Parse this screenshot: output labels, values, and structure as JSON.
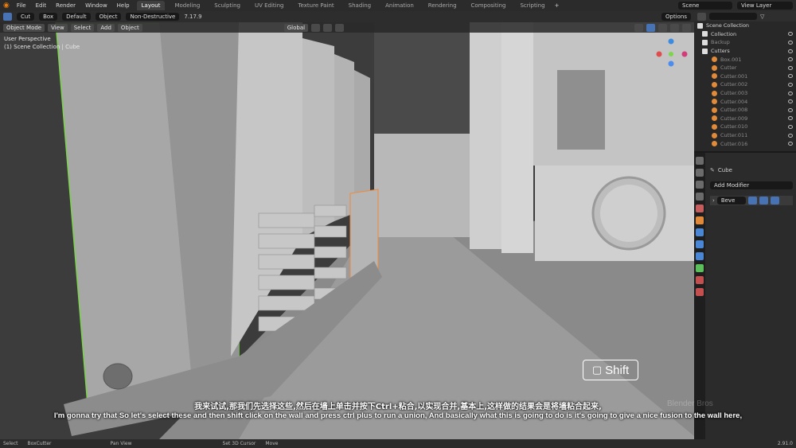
{
  "menu": [
    "File",
    "Edit",
    "Render",
    "Window",
    "Help"
  ],
  "workspaces": [
    "Layout",
    "Modeling",
    "Sculpting",
    "UV Editing",
    "Texture Paint",
    "Shading",
    "Animation",
    "Rendering",
    "Compositing",
    "Scripting"
  ],
  "active_workspace": "Layout",
  "scene": "Scene",
  "view_layer": "View Layer",
  "toolhdr": {
    "mode": "Cut",
    "shape": "Box",
    "default": "Default",
    "object": "Object",
    "boolean": "Non-Destructive",
    "version": "7.17.9",
    "options": "Options"
  },
  "vphdr": {
    "mode": "Object Mode",
    "view": "View",
    "select": "Select",
    "add": "Add",
    "object": "Object",
    "transform": "Global"
  },
  "viewport": {
    "line1": "User Perspective",
    "line2": "(1) Scene Collection | Cube"
  },
  "outliner": {
    "root": "Scene Collection",
    "rows": [
      {
        "label": "Collection",
        "dim": false
      },
      {
        "label": "Backup",
        "dim": true
      },
      {
        "label": "Cutters",
        "dim": false
      },
      {
        "label": "Box.001",
        "dim": true
      },
      {
        "label": "Cutter",
        "dim": true
      },
      {
        "label": "Cutter.001",
        "dim": true
      },
      {
        "label": "Cutter.002",
        "dim": true
      },
      {
        "label": "Cutter.003",
        "dim": true
      },
      {
        "label": "Cutter.004",
        "dim": true
      },
      {
        "label": "Cutter.008",
        "dim": true
      },
      {
        "label": "Cutter.009",
        "dim": true
      },
      {
        "label": "Cutter.010",
        "dim": true
      },
      {
        "label": "Cutter.011",
        "dim": true
      },
      {
        "label": "Cutter.016",
        "dim": true
      }
    ]
  },
  "properties": {
    "object": "Cube",
    "add_modifier": "Add Modifier",
    "modifier": "Beve"
  },
  "subtitle_cn": "我来试试,那我们先选择这些,然后在墙上单击并按下Ctrl+粘合,以实现合并,基本上,这样做的结果会是将墙粘合起来,",
  "subtitle_en": "I'm gonna try that So let's select these and then shift click on the wall and press ctrl plus to run a union, And basically what this is going to do is it's going to give a nice fusion to the wall here,",
  "key_overlay": "Shift",
  "watermark": "Blender Bros",
  "statusbar": {
    "select": "Select",
    "boxcutter": "BoxCutter",
    "pan": "Pan View",
    "cursor": "Set 3D Cursor",
    "move": "Move",
    "version": "2.91.0"
  },
  "colors": {
    "accent": "#4772b3",
    "outline": "#7bd64a",
    "active": "#f08a3a"
  }
}
